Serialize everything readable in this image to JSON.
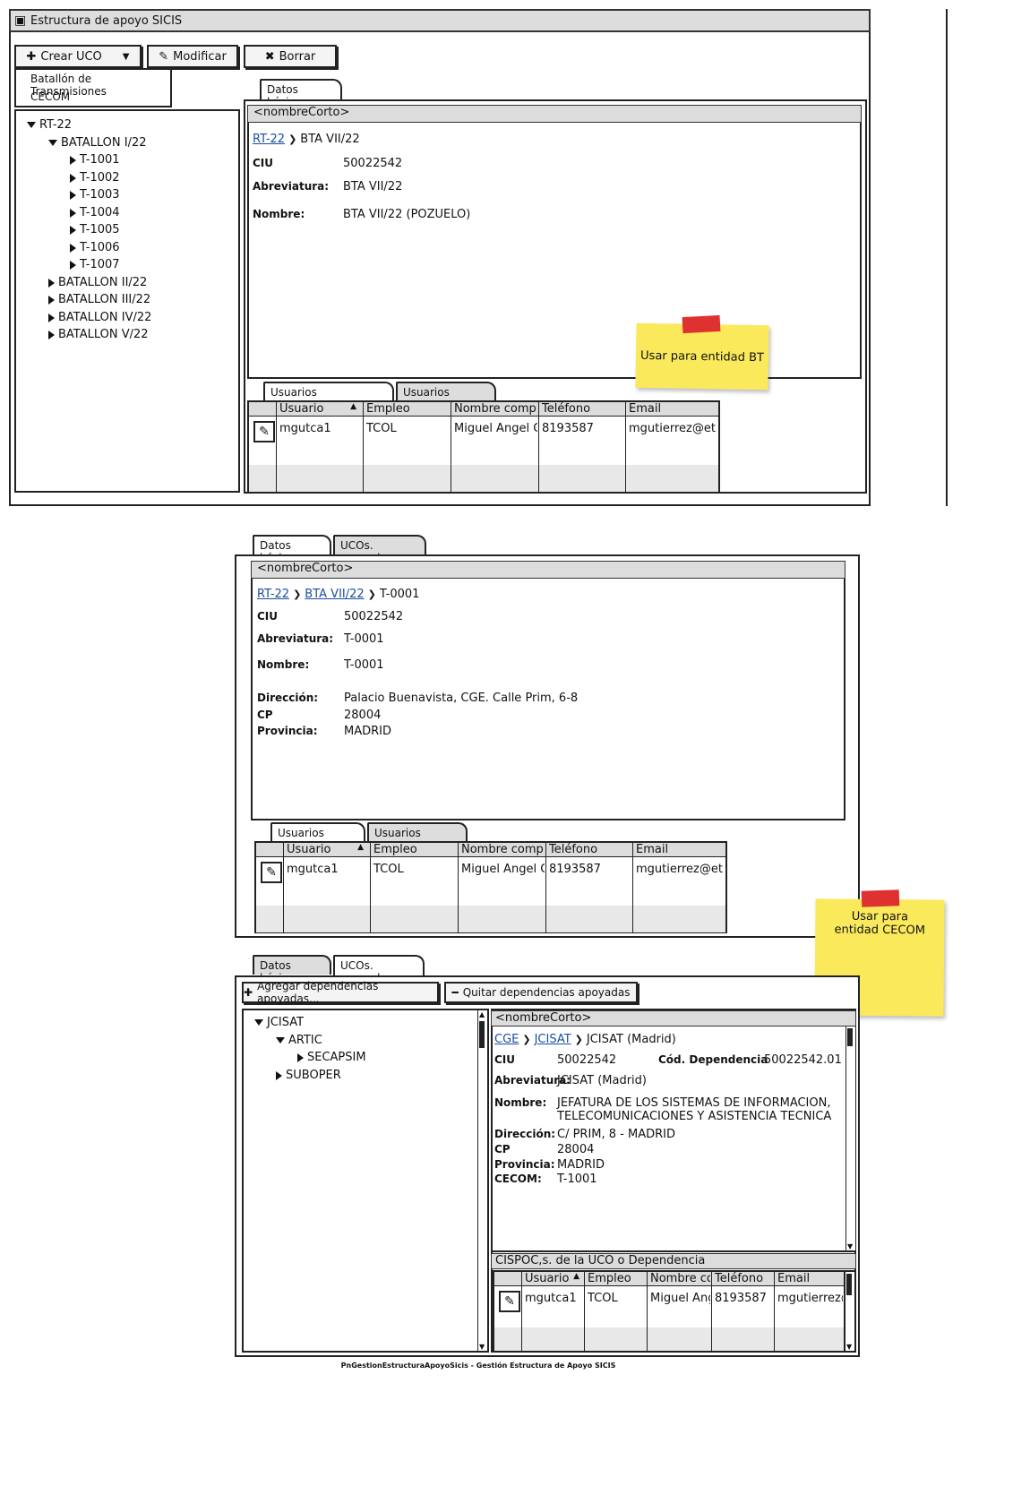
{
  "window": {
    "title": "Estructura de apoyo SICIS"
  },
  "toolbar": {
    "create_label": "Crear UCO",
    "modify_label": "Modificar",
    "delete_label": "Borrar"
  },
  "create_menu": {
    "items": [
      "Batallón de Transmisiones",
      "CECOM"
    ]
  },
  "tree1": {
    "root": "RT-22",
    "battalion1": "BATALLON I/22",
    "children": [
      "T-1001",
      "T-1002",
      "T-1003",
      "T-1004",
      "T-1005",
      "T-1006",
      "T-1007"
    ],
    "others": [
      "BATALLON II/22",
      "BATALLON III/22",
      "BATALLON IV/22",
      "BATALLON V/22"
    ]
  },
  "panel1": {
    "tab": "Datos básicos",
    "header": "<nombreCorto>",
    "crumb_link": "RT-22",
    "crumb_current": "BTA VII/22",
    "ciu_label": "CIU",
    "ciu": "50022542",
    "abbr_label": "Abreviatura:",
    "abbr": "BTA VII/22",
    "name_label": "Nombre:",
    "name": "BTA VII/22 (POZUELO)",
    "sticky": "Usar para entidad BT",
    "subtabs": [
      "Usuarios SUBDIRECTOR",
      "Usuarios CISPOC"
    ]
  },
  "users_table": {
    "columns": [
      "Usuario",
      "Empleo",
      "Nombre completo",
      "Teléfono",
      "Email"
    ],
    "row": [
      "mgutca1",
      "TCOL",
      "Miguel Angel Gutierrez",
      "8193587",
      "mgutierrez@et.mde.es"
    ]
  },
  "panel2": {
    "tabs": [
      "Datos básicos",
      "UCOs. apoyadas"
    ],
    "header": "<nombreCorto>",
    "crumb1": "RT-22",
    "crumb2": "BTA VII/22",
    "crumb_current": "T-0001",
    "ciu_label": "CIU",
    "ciu": "50022542",
    "abbr_label": "Abreviatura:",
    "abbr": "T-0001",
    "name_label": "Nombre:",
    "name": "T-0001",
    "addr_label": "Dirección:",
    "addr": "Palacio Buenavista, CGE. Calle Prim, 6-8",
    "cp_label": "CP",
    "cp": "28004",
    "prov_label": "Provincia:",
    "prov": "MADRID",
    "subtabs": [
      "Usuarios OACISE",
      "Usuarios CISPOC"
    ],
    "sticky": "Usar para entidad CECOM"
  },
  "panel3": {
    "tabs": [
      "Datos básicos",
      "UCOs. apoyadas"
    ],
    "add_label": "Agregar dependencias apoyadas...",
    "remove_label": "Quitar dependencias apoyadas",
    "tree": [
      "JCISAT",
      "ARTIC",
      "SECAPSIM",
      "SUBOPER"
    ],
    "header": "<nombreCorto>",
    "crumb1": "CGE",
    "crumb2": "JCISAT",
    "crumb_current": "JCISAT (Madrid)",
    "ciu_label": "CIU",
    "ciu": "50022542",
    "dep_label": "Cód. Dependencia",
    "dep": "50022542.01",
    "abbr_label": "Abreviatura:",
    "abbr": "JCISAT (Madrid)",
    "name_label": "Nombre:",
    "name1": "JEFATURA DE LOS SISTEMAS DE INFORMACION,",
    "name2": "TELECOMUNICACIONES Y ASISTENCIA TECNICA",
    "addr_label": "Dirección:",
    "addr": "C/ PRIM, 8 - MADRID",
    "cp_label": "CP",
    "cp": "28004",
    "prov_label": "Provincia:",
    "prov": "MADRID",
    "cecom_label": "CECOM:",
    "cecom": "T-1001",
    "cispoc_header": "CISPOC,s. de la UCO o Dependencia"
  },
  "footer": "PnGestionEstructuraApoyoSicis - Gestión Estructura de Apoyo SICIS"
}
